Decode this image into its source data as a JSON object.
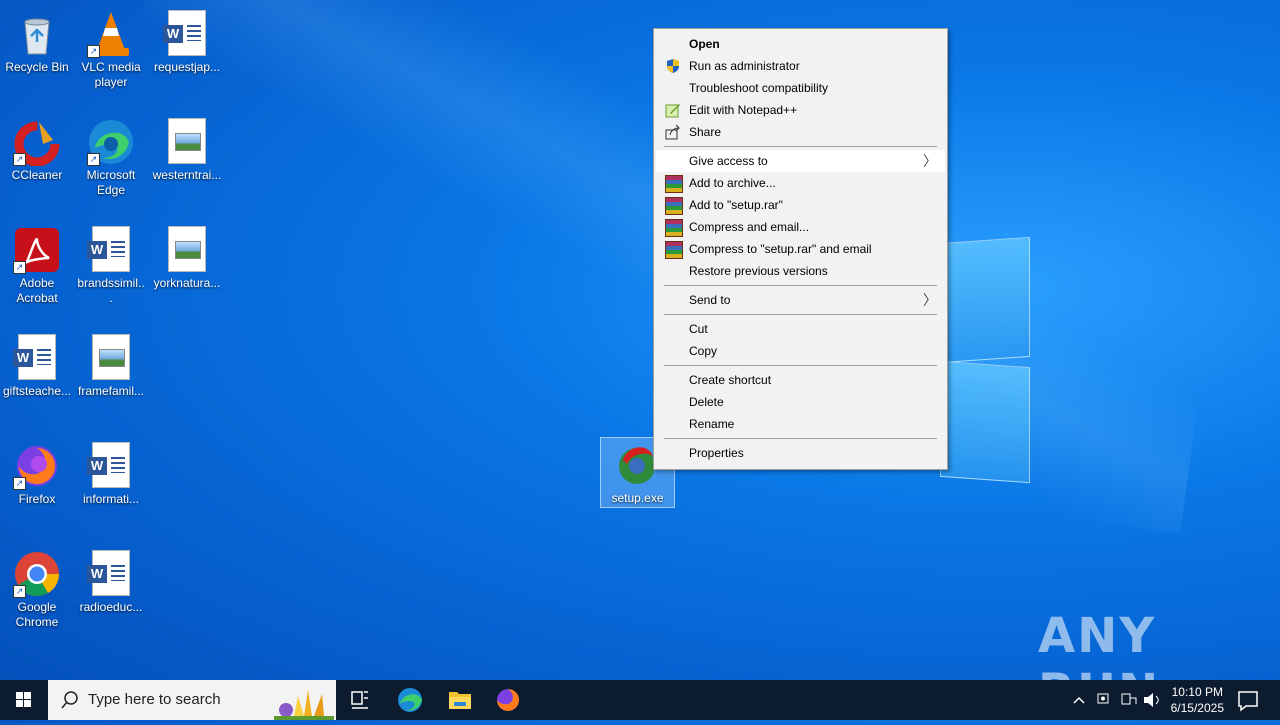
{
  "desktop": {
    "icons": [
      {
        "label": "Recycle Bin",
        "icon": "recycle-bin-icon"
      },
      {
        "label": "VLC media player",
        "icon": "vlc-icon"
      },
      {
        "label": "requestjap...",
        "icon": "word-doc-icon"
      },
      {
        "label": "CCleaner",
        "icon": "ccleaner-icon"
      },
      {
        "label": "Microsoft Edge",
        "icon": "edge-icon"
      },
      {
        "label": "westerntrai...",
        "icon": "image-file-icon"
      },
      {
        "label": "Adobe Acrobat",
        "icon": "acrobat-icon"
      },
      {
        "label": "brandssimil...",
        "icon": "word-doc-icon"
      },
      {
        "label": "yorknatura...",
        "icon": "image-file-icon"
      },
      {
        "label": "giftsteache...",
        "icon": "word-doc-icon"
      },
      {
        "label": "framefamil...",
        "icon": "image-file-icon"
      },
      {
        "label": "Firefox",
        "icon": "firefox-icon"
      },
      {
        "label": "informati...",
        "icon": "word-doc-icon"
      },
      {
        "label": "Google Chrome",
        "icon": "chrome-icon"
      },
      {
        "label": "radioeduc...",
        "icon": "word-doc-icon"
      },
      {
        "label": "setup.exe",
        "icon": "setup-exe-icon"
      }
    ]
  },
  "context_menu": {
    "items": [
      {
        "label": "Open",
        "bold": true
      },
      {
        "label": "Run as administrator",
        "icon": "uac-shield-icon"
      },
      {
        "label": "Troubleshoot compatibility"
      },
      {
        "label": "Edit with Notepad++",
        "icon": "notepadpp-icon"
      },
      {
        "label": "Share",
        "icon": "share-icon"
      },
      {
        "label": "Give access to",
        "submenu": true,
        "highlighted": true
      },
      {
        "label": "Add to archive...",
        "icon": "winrar-icon"
      },
      {
        "label": "Add to \"setup.rar\"",
        "icon": "winrar-icon"
      },
      {
        "label": "Compress and email...",
        "icon": "winrar-icon"
      },
      {
        "label": "Compress to \"setup.rar\" and email",
        "icon": "winrar-icon"
      },
      {
        "label": "Restore previous versions"
      },
      {
        "label": "Send to",
        "submenu": true
      },
      {
        "label": "Cut"
      },
      {
        "label": "Copy"
      },
      {
        "label": "Create shortcut"
      },
      {
        "label": "Delete"
      },
      {
        "label": "Rename"
      },
      {
        "label": "Properties"
      }
    ]
  },
  "taskbar": {
    "search_placeholder": "Type here to search",
    "pinned": [
      "task-view-icon",
      "edge-icon",
      "file-explorer-icon",
      "firefox-icon"
    ],
    "clock_time": "10:10 PM",
    "clock_date": "6/15/2025"
  },
  "watermark": "ANY RUN",
  "colors": {
    "taskbar": "#0d1b2e",
    "menu_bg": "#f2f2f2",
    "desktop_accent": "#0a78e6"
  }
}
